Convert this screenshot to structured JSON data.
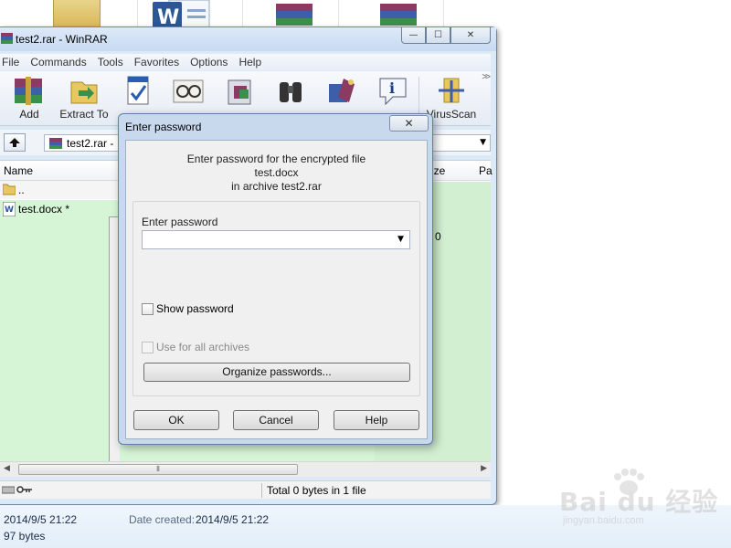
{
  "desktop": {
    "icons": [
      "folder-icon",
      "word-document-icon",
      "winrar-archive-icon",
      "winrar-archive-icon"
    ]
  },
  "window": {
    "title": "test2.rar - WinRAR",
    "controls": {
      "minimize": "—",
      "maximize": "☐",
      "close": "✕"
    }
  },
  "menu": {
    "items": [
      "File",
      "Commands",
      "Tools",
      "Favorites",
      "Options",
      "Help"
    ]
  },
  "toolbar": {
    "add_label": "Add",
    "extract_label": "Extract To",
    "virusscan_label": "VirusScan"
  },
  "address": {
    "path": "test2.rar - "
  },
  "filelist": {
    "columns": {
      "name": "Name",
      "size": "Size",
      "packed": "Pa"
    },
    "rows": [
      {
        "name": "..",
        "icon": "folder-icon"
      },
      {
        "name": "test.docx *",
        "icon": "word-document-icon",
        "size": "0"
      }
    ]
  },
  "statusbar": {
    "total": "Total 0 bytes in 1 file"
  },
  "details": {
    "modified": "2014/9/5 21:22",
    "created_label": "Date created:",
    "created": "2014/9/5 21:22",
    "size": "97 bytes"
  },
  "watermark": {
    "brand": "Bai du 经验",
    "url": "jingyan.baidu.com"
  },
  "dialog": {
    "title": "Enter password",
    "message_line1": "Enter password for the encrypted file",
    "message_line2": "test.docx",
    "message_line3": "in archive test2.rar",
    "password_label": "Enter password",
    "password_value": "",
    "show_password_label": "Show password",
    "show_password_checked": false,
    "use_all_label": "Use for all archives",
    "use_all_checked": false,
    "use_all_enabled": false,
    "organize_label": "Organize passwords...",
    "ok_label": "OK",
    "cancel_label": "Cancel",
    "help_label": "Help",
    "close_label": "✕"
  }
}
